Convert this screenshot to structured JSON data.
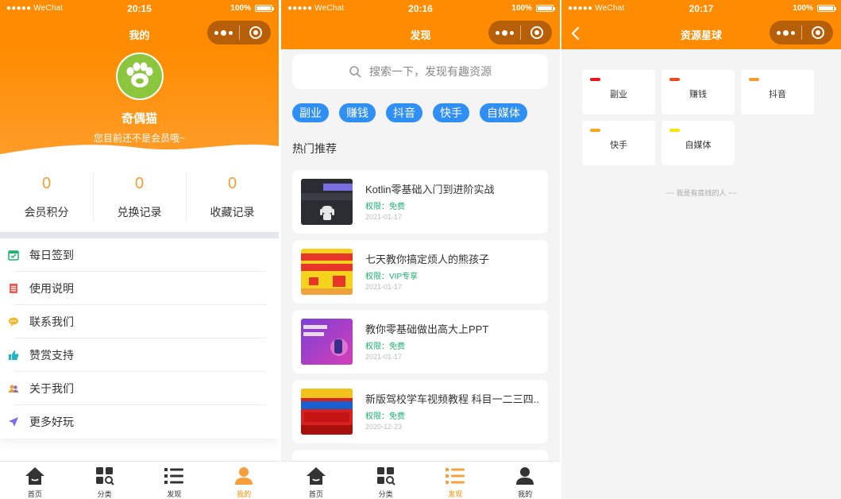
{
  "statusbar": {
    "carrier": "●●●●● WeChat",
    "battery": "100%",
    "times": [
      "20:15",
      "20:16",
      "20:17"
    ]
  },
  "colors": {
    "brand": "#ff8c00",
    "tag": "#2f8ff5",
    "free": "#19b36b"
  },
  "panel1": {
    "title": "我的",
    "username": "奇偶猫",
    "subtitle": "您目前还不是会员哦~",
    "stats": [
      {
        "value": "0",
        "label": "会员积分"
      },
      {
        "value": "0",
        "label": "兑换记录"
      },
      {
        "value": "0",
        "label": "收藏记录"
      }
    ],
    "menu": [
      {
        "label": "每日签到",
        "icon": "calendar-check-icon"
      },
      {
        "label": "使用说明",
        "icon": "document-icon"
      },
      {
        "label": "联系我们",
        "icon": "chat-icon"
      },
      {
        "label": "赞赏支持",
        "icon": "thumbs-up-icon"
      },
      {
        "label": "关于我们",
        "icon": "people-icon"
      },
      {
        "label": "更多好玩",
        "icon": "send-icon"
      }
    ]
  },
  "panel2": {
    "title": "发现",
    "search_placeholder": "搜索一下，发现有趣资源",
    "tags": [
      "副业",
      "赚钱",
      "抖音",
      "快手",
      "自媒体"
    ],
    "section_title": "热门推荐",
    "items": [
      {
        "title": "Kotlin零基础入门到进阶实战",
        "perm": "权限：免费",
        "date": "2021-01-17",
        "thumb": "kotlin-thumb"
      },
      {
        "title": "七天教你搞定烦人的熊孩子",
        "perm": "权限：VIP专享",
        "date": "2021-01-17",
        "thumb": "kids-thumb"
      },
      {
        "title": "教你零基础做出高大上PPT",
        "perm": "权限：免费",
        "date": "2021-01-17",
        "thumb": "ppt-thumb"
      },
      {
        "title": "新版驾校学车视频教程 科目一二三四...",
        "perm": "权限：免费",
        "date": "2020-12-23",
        "thumb": "driving-thumb"
      }
    ]
  },
  "panel3": {
    "title": "资源星球",
    "planets": [
      {
        "label": "副业",
        "color": "#e8141e"
      },
      {
        "label": "赚钱",
        "color": "#ee4b22"
      },
      {
        "label": "抖音",
        "color": "#f59b2a"
      },
      {
        "label": "快手",
        "color": "#f5a623"
      },
      {
        "label": "自媒体",
        "color": "#f5e70a"
      }
    ],
    "bottom_line": "~~ 我是有底线的人 ~~"
  },
  "tabbar": {
    "tabs": [
      "首页",
      "分类",
      "发现",
      "我的"
    ]
  }
}
